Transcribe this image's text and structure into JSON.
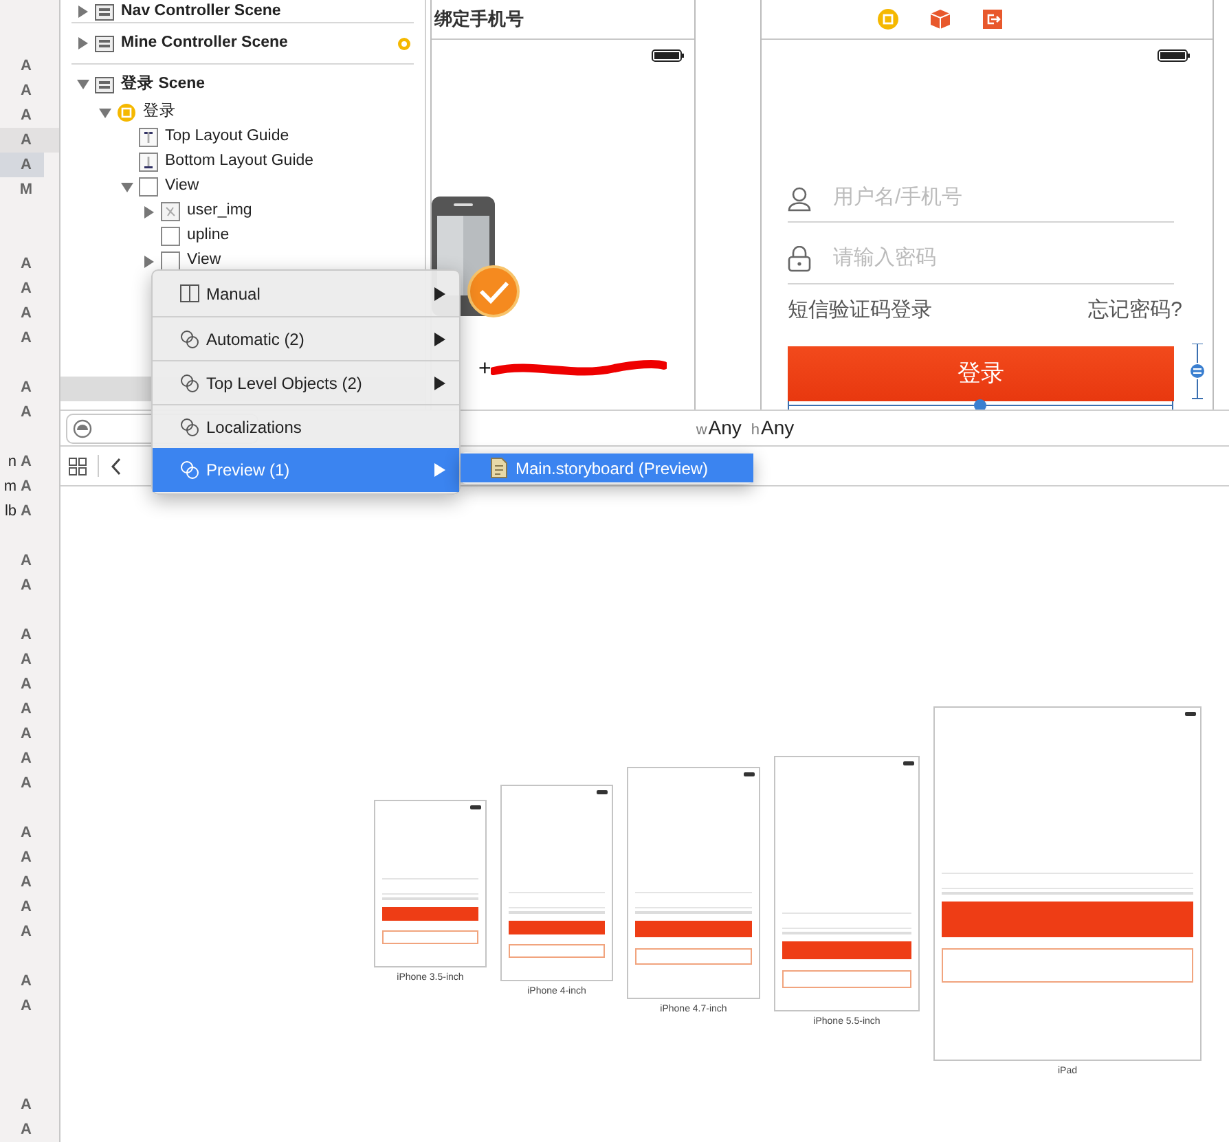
{
  "vcs_status": [
    {
      "status": "A",
      "selected": false
    },
    {
      "status": "A",
      "selected": false
    },
    {
      "status": "A",
      "selected": false
    },
    {
      "status": "A",
      "selected": false,
      "highlighted": true
    },
    {
      "status": "A",
      "selected": true
    },
    {
      "status": "M",
      "selected": false
    },
    {
      "status": "A",
      "selected": false
    },
    {
      "status": "A",
      "selected": false
    },
    {
      "status": "A",
      "selected": false
    },
    {
      "status": "A",
      "selected": false
    },
    {
      "status": "A",
      "selected": false
    },
    {
      "status": "A",
      "selected": false
    },
    {
      "name": "n",
      "status": "A",
      "selected": false
    },
    {
      "name": "m",
      "status": "A",
      "selected": false
    },
    {
      "name": "lb",
      "status": "A",
      "selected": false
    },
    {
      "status": "A",
      "selected": false
    },
    {
      "status": "A",
      "selected": false
    },
    {
      "status": "A",
      "selected": false
    },
    {
      "status": "A",
      "selected": false
    },
    {
      "status": "A",
      "selected": false
    },
    {
      "status": "A",
      "selected": false
    },
    {
      "status": "A",
      "selected": false
    },
    {
      "status": "A",
      "selected": false
    },
    {
      "status": "A",
      "selected": false
    },
    {
      "status": "A",
      "selected": false
    },
    {
      "status": "A",
      "selected": false
    },
    {
      "status": "A",
      "selected": false
    },
    {
      "status": "A",
      "selected": false
    },
    {
      "status": "A",
      "selected": false
    },
    {
      "status": "A",
      "selected": false
    },
    {
      "status": "A",
      "selected": false
    },
    {
      "status": "A",
      "selected": false
    },
    {
      "status": "A",
      "selected": false
    }
  ],
  "outline": [
    {
      "label": "Nav Controller Scene",
      "kind": "scene",
      "expanded": false
    },
    {
      "label": "Mine Controller Scene",
      "kind": "scene",
      "expanded": false,
      "warning": true
    },
    {
      "label": "登录 Scene",
      "kind": "scene",
      "expanded": true,
      "children": [
        {
          "label": "登录",
          "kind": "controller",
          "expanded": true,
          "children": [
            {
              "label": "Top Layout Guide",
              "kind": "top_guide"
            },
            {
              "label": "Bottom Layout Guide",
              "kind": "bottom_guide"
            },
            {
              "label": "View",
              "kind": "view",
              "expanded": true,
              "children": [
                {
                  "label": "user_img",
                  "kind": "image",
                  "expanded": false
                },
                {
                  "label": "upline",
                  "kind": "view"
                },
                {
                  "label": "View",
                  "kind": "view",
                  "expanded": false
                }
              ]
            }
          ]
        }
      ]
    }
  ],
  "bind_scene": {
    "title": "绑定手机号",
    "phone_number": "+"
  },
  "login_scene": {
    "username_placeholder": "用户名/手机号",
    "password_placeholder": "请输入密码",
    "sms_login": "短信验证码登录",
    "forgot_password": "忘记密码?",
    "login_button": "登录"
  },
  "size_class": {
    "w_prefix": "w",
    "width": "Any",
    "h_prefix": "h",
    "height": "Any"
  },
  "context_menu": [
    {
      "label": "Manual",
      "kind": "split",
      "submenu": true,
      "selected": false
    },
    {
      "label": "Automatic (2)",
      "kind": "rings",
      "submenu": true,
      "selected": false
    },
    {
      "label": "Top Level Objects (2)",
      "kind": "rings",
      "submenu": true,
      "selected": false
    },
    {
      "label": "Localizations",
      "kind": "rings",
      "submenu": false,
      "selected": false
    },
    {
      "label": "Preview (1)",
      "kind": "rings",
      "submenu": true,
      "selected": true
    }
  ],
  "submenu": [
    {
      "label": "Main.storyboard (Preview)",
      "selected": true
    }
  ],
  "previews": [
    {
      "label": "iPhone 3.5-inch"
    },
    {
      "label": "iPhone 4-inch"
    },
    {
      "label": "iPhone 4.7-inch"
    },
    {
      "label": "iPhone 5.5-inch"
    },
    {
      "label": "iPad"
    }
  ]
}
